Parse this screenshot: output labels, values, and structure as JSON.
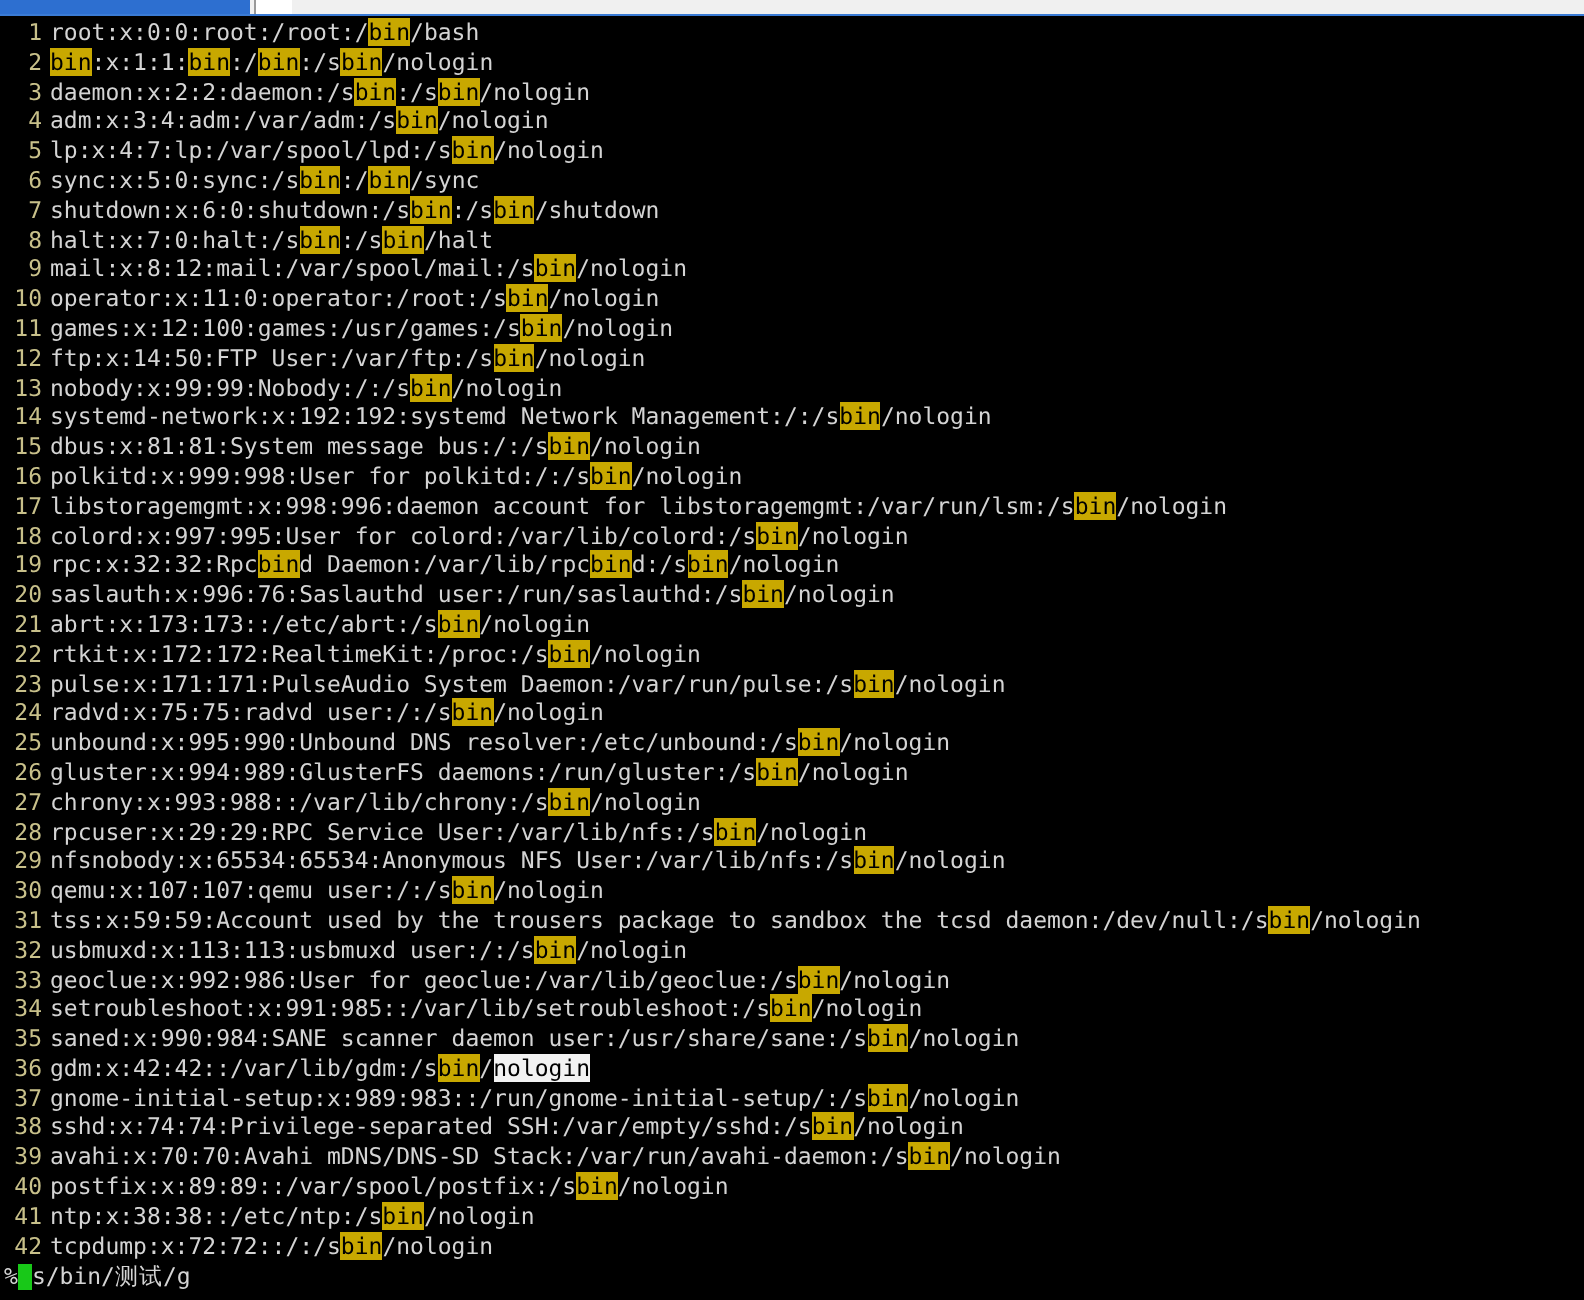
{
  "tabs": [
    {
      "selected": true
    },
    {
      "selected": false
    }
  ],
  "editor": {
    "lines": [
      {
        "number": "1",
        "segments": [
          {
            "text": "root:x:0:0:root:/root:/"
          },
          {
            "text": "bin",
            "highlighted": true
          },
          {
            "text": "/bash"
          }
        ]
      },
      {
        "number": "2",
        "segments": [
          {
            "text": "bin",
            "highlighted": true
          },
          {
            "text": ":x:1:1:"
          },
          {
            "text": "bin",
            "highlighted": true
          },
          {
            "text": ":/"
          },
          {
            "text": "bin",
            "highlighted": true
          },
          {
            "text": ":/s"
          },
          {
            "text": "bin",
            "highlighted": true
          },
          {
            "text": "/nologin"
          }
        ]
      },
      {
        "number": "3",
        "segments": [
          {
            "text": "daemon:x:2:2:daemon:/s"
          },
          {
            "text": "bin",
            "highlighted": true
          },
          {
            "text": ":/s"
          },
          {
            "text": "bin",
            "highlighted": true
          },
          {
            "text": "/nologin"
          }
        ]
      },
      {
        "number": "4",
        "segments": [
          {
            "text": "adm:x:3:4:adm:/var/adm:/s"
          },
          {
            "text": "bin",
            "highlighted": true
          },
          {
            "text": "/nologin"
          }
        ]
      },
      {
        "number": "5",
        "segments": [
          {
            "text": "lp:x:4:7:lp:/var/spool/lpd:/s"
          },
          {
            "text": "bin",
            "highlighted": true
          },
          {
            "text": "/nologin"
          }
        ]
      },
      {
        "number": "6",
        "segments": [
          {
            "text": "sync:x:5:0:sync:/s"
          },
          {
            "text": "bin",
            "highlighted": true
          },
          {
            "text": ":/"
          },
          {
            "text": "bin",
            "highlighted": true
          },
          {
            "text": "/sync"
          }
        ]
      },
      {
        "number": "7",
        "segments": [
          {
            "text": "shutdown:x:6:0:shutdown:/s"
          },
          {
            "text": "bin",
            "highlighted": true
          },
          {
            "text": ":/s"
          },
          {
            "text": "bin",
            "highlighted": true
          },
          {
            "text": "/shutdown"
          }
        ]
      },
      {
        "number": "8",
        "segments": [
          {
            "text": "halt:x:7:0:halt:/s"
          },
          {
            "text": "bin",
            "highlighted": true
          },
          {
            "text": ":/s"
          },
          {
            "text": "bin",
            "highlighted": true
          },
          {
            "text": "/halt"
          }
        ]
      },
      {
        "number": "9",
        "segments": [
          {
            "text": "mail:x:8:12:mail:/var/spool/mail:/s"
          },
          {
            "text": "bin",
            "highlighted": true
          },
          {
            "text": "/nologin"
          }
        ]
      },
      {
        "number": "10",
        "segments": [
          {
            "text": "operator:x:11:0:operator:/root:/s"
          },
          {
            "text": "bin",
            "highlighted": true
          },
          {
            "text": "/nologin"
          }
        ]
      },
      {
        "number": "11",
        "segments": [
          {
            "text": "games:x:12:100:games:/usr/games:/s"
          },
          {
            "text": "bin",
            "highlighted": true
          },
          {
            "text": "/nologin"
          }
        ]
      },
      {
        "number": "12",
        "segments": [
          {
            "text": "ftp:x:14:50:FTP User:/var/ftp:/s"
          },
          {
            "text": "bin",
            "highlighted": true
          },
          {
            "text": "/nologin"
          }
        ]
      },
      {
        "number": "13",
        "segments": [
          {
            "text": "nobody:x:99:99:Nobody:/:/s"
          },
          {
            "text": "bin",
            "highlighted": true
          },
          {
            "text": "/nologin"
          }
        ]
      },
      {
        "number": "14",
        "segments": [
          {
            "text": "systemd-network:x:192:192:systemd Network Management:/:/s"
          },
          {
            "text": "bin",
            "highlighted": true
          },
          {
            "text": "/nologin"
          }
        ]
      },
      {
        "number": "15",
        "segments": [
          {
            "text": "dbus:x:81:81:System message bus:/:/s"
          },
          {
            "text": "bin",
            "highlighted": true
          },
          {
            "text": "/nologin"
          }
        ]
      },
      {
        "number": "16",
        "segments": [
          {
            "text": "polkitd:x:999:998:User for polkitd:/:/s"
          },
          {
            "text": "bin",
            "highlighted": true
          },
          {
            "text": "/nologin"
          }
        ]
      },
      {
        "number": "17",
        "segments": [
          {
            "text": "libstoragemgmt:x:998:996:daemon account for libstoragemgmt:/var/run/lsm:/s"
          },
          {
            "text": "bin",
            "highlighted": true
          },
          {
            "text": "/nologin"
          }
        ]
      },
      {
        "number": "18",
        "segments": [
          {
            "text": "colord:x:997:995:User for colord:/var/lib/colord:/s"
          },
          {
            "text": "bin",
            "highlighted": true
          },
          {
            "text": "/nologin"
          }
        ]
      },
      {
        "number": "19",
        "segments": [
          {
            "text": "rpc:x:32:32:Rpc"
          },
          {
            "text": "bin",
            "highlighted": true
          },
          {
            "text": "d Daemon:/var/lib/rpc"
          },
          {
            "text": "bin",
            "highlighted": true
          },
          {
            "text": "d:/s"
          },
          {
            "text": "bin",
            "highlighted": true
          },
          {
            "text": "/nologin"
          }
        ]
      },
      {
        "number": "20",
        "segments": [
          {
            "text": "saslauth:x:996:76:Saslauthd user:/run/saslauthd:/s"
          },
          {
            "text": "bin",
            "highlighted": true
          },
          {
            "text": "/nologin"
          }
        ]
      },
      {
        "number": "21",
        "segments": [
          {
            "text": "abrt:x:173:173::/etc/abrt:/s"
          },
          {
            "text": "bin",
            "highlighted": true
          },
          {
            "text": "/nologin"
          }
        ]
      },
      {
        "number": "22",
        "segments": [
          {
            "text": "rtkit:x:172:172:RealtimeKit:/proc:/s"
          },
          {
            "text": "bin",
            "highlighted": true
          },
          {
            "text": "/nologin"
          }
        ]
      },
      {
        "number": "23",
        "segments": [
          {
            "text": "pulse:x:171:171:PulseAudio System Daemon:/var/run/pulse:/s"
          },
          {
            "text": "bin",
            "highlighted": true
          },
          {
            "text": "/nologin"
          }
        ]
      },
      {
        "number": "24",
        "segments": [
          {
            "text": "radvd:x:75:75:radvd user:/:/s"
          },
          {
            "text": "bin",
            "highlighted": true
          },
          {
            "text": "/nologin"
          }
        ]
      },
      {
        "number": "25",
        "segments": [
          {
            "text": "unbound:x:995:990:Unbound DNS resolver:/etc/unbound:/s"
          },
          {
            "text": "bin",
            "highlighted": true
          },
          {
            "text": "/nologin"
          }
        ]
      },
      {
        "number": "26",
        "segments": [
          {
            "text": "gluster:x:994:989:GlusterFS daemons:/run/gluster:/s"
          },
          {
            "text": "bin",
            "highlighted": true
          },
          {
            "text": "/nologin"
          }
        ]
      },
      {
        "number": "27",
        "segments": [
          {
            "text": "chrony:x:993:988::/var/lib/chrony:/s"
          },
          {
            "text": "bin",
            "highlighted": true
          },
          {
            "text": "/nologin"
          }
        ]
      },
      {
        "number": "28",
        "segments": [
          {
            "text": "rpcuser:x:29:29:RPC Service User:/var/lib/nfs:/s"
          },
          {
            "text": "bin",
            "highlighted": true
          },
          {
            "text": "/nologin"
          }
        ]
      },
      {
        "number": "29",
        "segments": [
          {
            "text": "nfsnobody:x:65534:65534:Anonymous NFS User:/var/lib/nfs:/s"
          },
          {
            "text": "bin",
            "highlighted": true
          },
          {
            "text": "/nologin"
          }
        ]
      },
      {
        "number": "30",
        "segments": [
          {
            "text": "qemu:x:107:107:qemu user:/:/s"
          },
          {
            "text": "bin",
            "highlighted": true
          },
          {
            "text": "/nologin"
          }
        ]
      },
      {
        "number": "31",
        "segments": [
          {
            "text": "tss:x:59:59:Account used by the trousers package to sandbox the tcsd daemon:/dev/null:/s"
          },
          {
            "text": "bin",
            "highlighted": true
          },
          {
            "text": "/nologin"
          }
        ]
      },
      {
        "number": "32",
        "segments": [
          {
            "text": "usbmuxd:x:113:113:usbmuxd user:/:/s"
          },
          {
            "text": "bin",
            "highlighted": true
          },
          {
            "text": "/nologin"
          }
        ]
      },
      {
        "number": "33",
        "segments": [
          {
            "text": "geoclue:x:992:986:User for geoclue:/var/lib/geoclue:/s"
          },
          {
            "text": "bin",
            "highlighted": true
          },
          {
            "text": "/nologin"
          }
        ]
      },
      {
        "number": "34",
        "segments": [
          {
            "text": "setroubleshoot:x:991:985::/var/lib/setroubleshoot:/s"
          },
          {
            "text": "bin",
            "highlighted": true
          },
          {
            "text": "/nologin"
          }
        ]
      },
      {
        "number": "35",
        "segments": [
          {
            "text": "saned:x:990:984:SANE scanner daemon user:/usr/share/sane:/s"
          },
          {
            "text": "bin",
            "highlighted": true
          },
          {
            "text": "/nologin"
          }
        ]
      },
      {
        "number": "36",
        "segments": [
          {
            "text": "gdm:x:42:42::/var/lib/gdm:/s"
          },
          {
            "text": "bin",
            "highlighted": true
          },
          {
            "text": "/"
          },
          {
            "text": "nologin",
            "highlighted": true,
            "current": true
          }
        ]
      },
      {
        "number": "37",
        "segments": [
          {
            "text": "gnome-initial-setup:x:989:983::/run/gnome-initial-setup/:/s"
          },
          {
            "text": "bin",
            "highlighted": true
          },
          {
            "text": "/nologin"
          }
        ]
      },
      {
        "number": "38",
        "segments": [
          {
            "text": "sshd:x:74:74:Privilege-separated SSH:/var/empty/sshd:/s"
          },
          {
            "text": "bin",
            "highlighted": true
          },
          {
            "text": "/nologin"
          }
        ]
      },
      {
        "number": "39",
        "segments": [
          {
            "text": "avahi:x:70:70:Avahi mDNS/DNS-SD Stack:/var/run/avahi-daemon:/s"
          },
          {
            "text": "bin",
            "highlighted": true
          },
          {
            "text": "/nologin"
          }
        ]
      },
      {
        "number": "40",
        "segments": [
          {
            "text": "postfix:x:89:89::/var/spool/postfix:/s"
          },
          {
            "text": "bin",
            "highlighted": true
          },
          {
            "text": "/nologin"
          }
        ]
      },
      {
        "number": "41",
        "segments": [
          {
            "text": "ntp:x:38:38::/etc/ntp:/s"
          },
          {
            "text": "bin",
            "highlighted": true
          },
          {
            "text": "/nologin"
          }
        ]
      },
      {
        "number": "42",
        "segments": [
          {
            "text": "tcpdump:x:72:72::/:/s"
          },
          {
            "text": "bin",
            "highlighted": true
          },
          {
            "text": "/nologin"
          }
        ]
      }
    ]
  },
  "command_line": {
    "before_cursor": "%",
    "after_cursor": "s/bin/测试/g"
  }
}
